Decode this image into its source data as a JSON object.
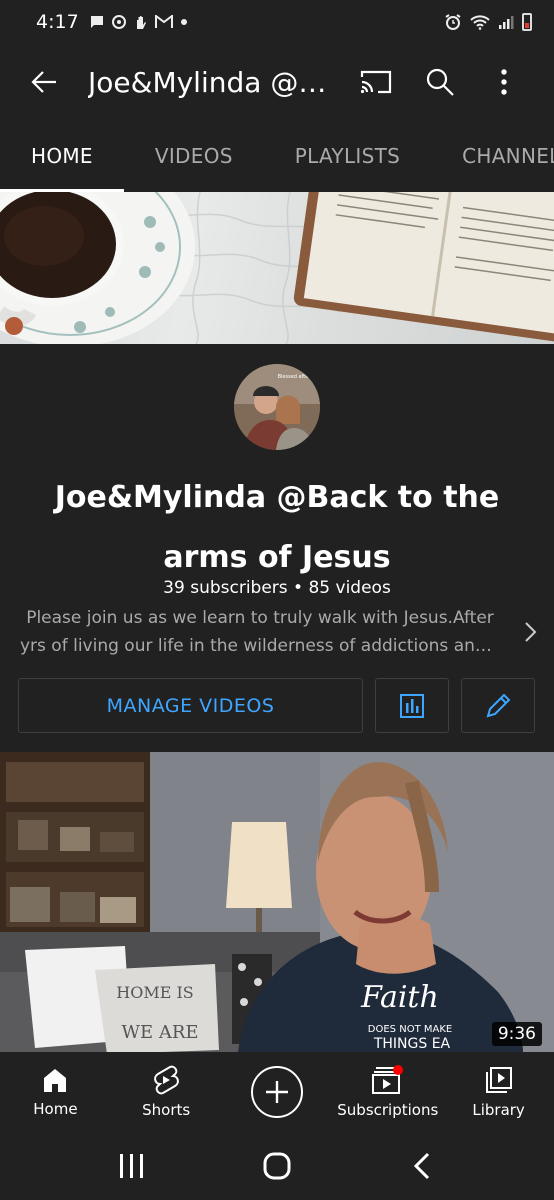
{
  "status_bar": {
    "time": "4:17",
    "left_icons": [
      "message-icon",
      "sync-icon",
      "hand-icon",
      "gmail-icon",
      "dot-icon"
    ],
    "right_icons": [
      "alarm-icon",
      "wifi-icon",
      "signal-icon",
      "battery-icon"
    ]
  },
  "app_bar": {
    "title": "Joe&Mylinda @Back to the arms of Jesus",
    "actions": [
      "cast-icon",
      "search-icon",
      "more-vert-icon"
    ]
  },
  "tabs": [
    {
      "label": "HOME",
      "active": true
    },
    {
      "label": "VIDEOS",
      "active": false
    },
    {
      "label": "PLAYLISTS",
      "active": false
    },
    {
      "label": "CHANNELS",
      "active": false
    }
  ],
  "channel": {
    "avatar_caption": "Blessed after",
    "name": "Joe&Mylinda @Back to the arms of Jesus",
    "stats": "39 subscribers • 85 videos",
    "description_line1": "Please join us as we learn to truly walk with Jesus.After",
    "description_line2": "yrs of living our life in the wilderness of addictions and dis..."
  },
  "buttons": {
    "manage_videos": "MANAGE VIDEOS"
  },
  "video": {
    "duration": "9:36",
    "pillow_text": "HOME IS WHERE WE ARE",
    "shirt_text": "Faith DOES NOT MAKE THINGS EASY IT MAKES"
  },
  "bottom_nav": [
    {
      "label": "Home",
      "icon": "home-icon"
    },
    {
      "label": "Shorts",
      "icon": "shorts-icon"
    },
    {
      "label": "",
      "icon": "create-icon"
    },
    {
      "label": "Subscriptions",
      "icon": "subscriptions-icon"
    },
    {
      "label": "Library",
      "icon": "library-icon"
    }
  ],
  "colors": {
    "background": "#212121",
    "accent_blue": "#3ea6ff",
    "notification_red": "#ff0000",
    "muted_text": "#aaaaaa"
  }
}
